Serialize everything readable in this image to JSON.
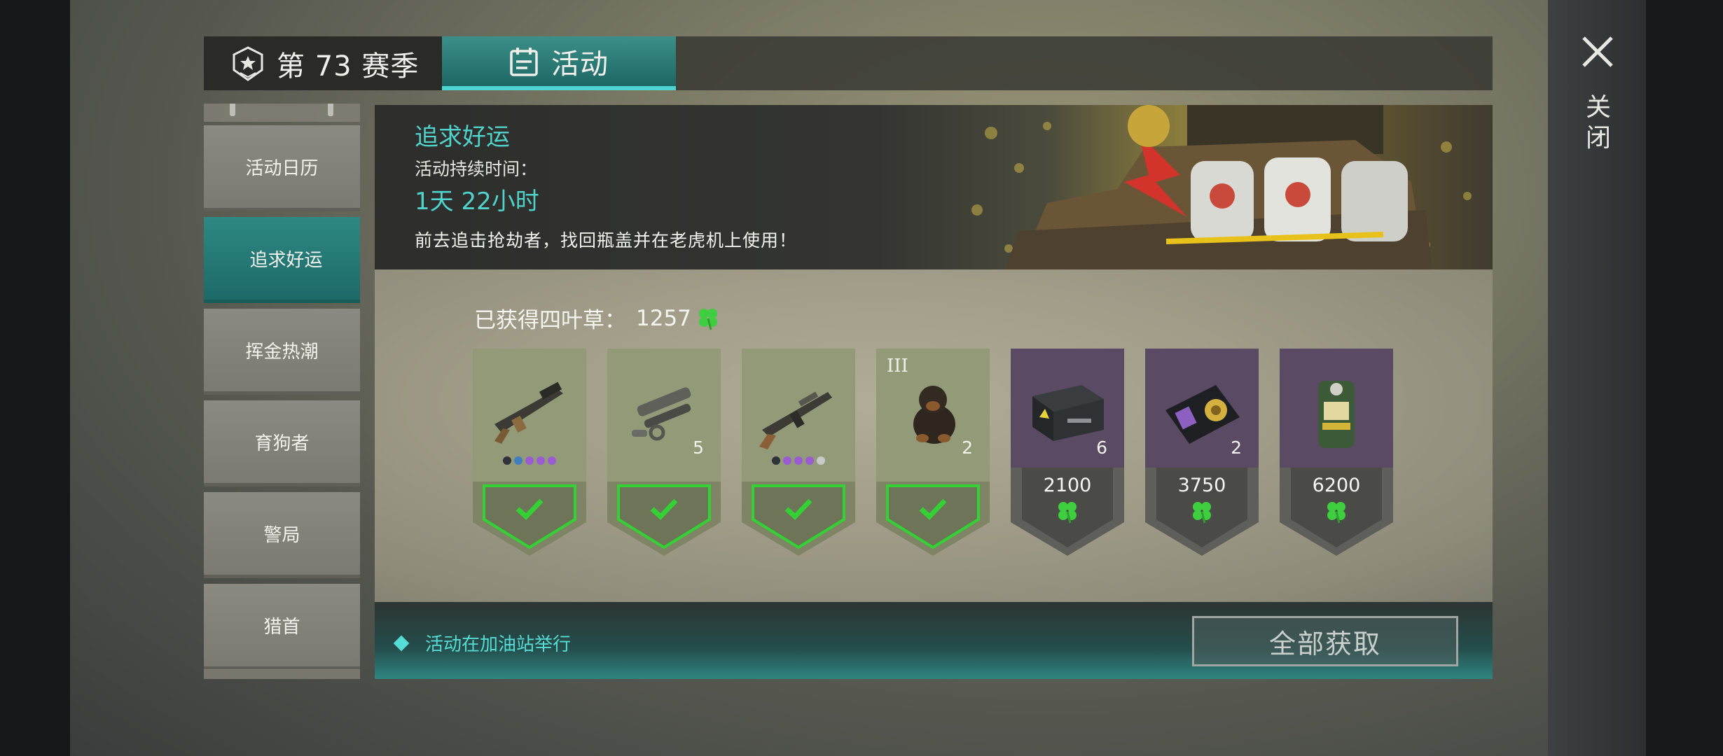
{
  "tabs": {
    "season_label": "第 73 赛季",
    "activity_label": "活动"
  },
  "close": {
    "label": "关闭"
  },
  "sidebar": {
    "items": [
      {
        "label": "活动日历",
        "active": false
      },
      {
        "label": "追求好运",
        "active": true
      },
      {
        "label": "挥金热潮",
        "active": false
      },
      {
        "label": "育狗者",
        "active": false
      },
      {
        "label": "警局",
        "active": false
      },
      {
        "label": "猎首",
        "active": false
      }
    ]
  },
  "event": {
    "title": "追求好运",
    "duration_label": "活动持续时间：",
    "duration_value": "1天 22小时",
    "description": "前去追击抢劫者，找回瓶盖并在老虎机上使用！"
  },
  "clovers": {
    "label": "已获得四叶草：",
    "count": "1257"
  },
  "rewards": [
    {
      "item": "rifle-silencer",
      "claimed": true,
      "quantity": "",
      "tier": "",
      "price": "",
      "rarity_dots": [
        "#2f3338",
        "#3f7fc0",
        "#9a5cd0",
        "#9a5cd0",
        "#9a5cd0"
      ]
    },
    {
      "item": "scope-parts",
      "claimed": true,
      "quantity": "5",
      "tier": "",
      "price": "",
      "rarity_dots": []
    },
    {
      "item": "assault-rifle",
      "claimed": true,
      "quantity": "",
      "tier": "",
      "price": "",
      "rarity_dots": [
        "#2f3338",
        "#9a5cd0",
        "#9a5cd0",
        "#9a5cd0",
        "#c9c9c9"
      ]
    },
    {
      "item": "rottweiler-puppy",
      "claimed": true,
      "quantity": "2",
      "tier": "III",
      "price": "",
      "rarity_dots": []
    },
    {
      "item": "weapon-crate",
      "claimed": false,
      "quantity": "6",
      "tier": "",
      "price": "2100",
      "rarity_dots": []
    },
    {
      "item": "police-badge",
      "claimed": false,
      "quantity": "2",
      "tier": "",
      "price": "3750",
      "rarity_dots": []
    },
    {
      "item": "slot-machine",
      "claimed": false,
      "quantity": "",
      "tier": "",
      "price": "6200",
      "rarity_dots": []
    }
  ],
  "footer": {
    "note": "活动在加油站举行",
    "claim_all_label": "全部获取"
  },
  "colors": {
    "accent_teal": "#4fd3cc",
    "claimed_green": "#33d134",
    "locked_purple": "#5a4a63",
    "clover_green": "#3fce3f"
  }
}
